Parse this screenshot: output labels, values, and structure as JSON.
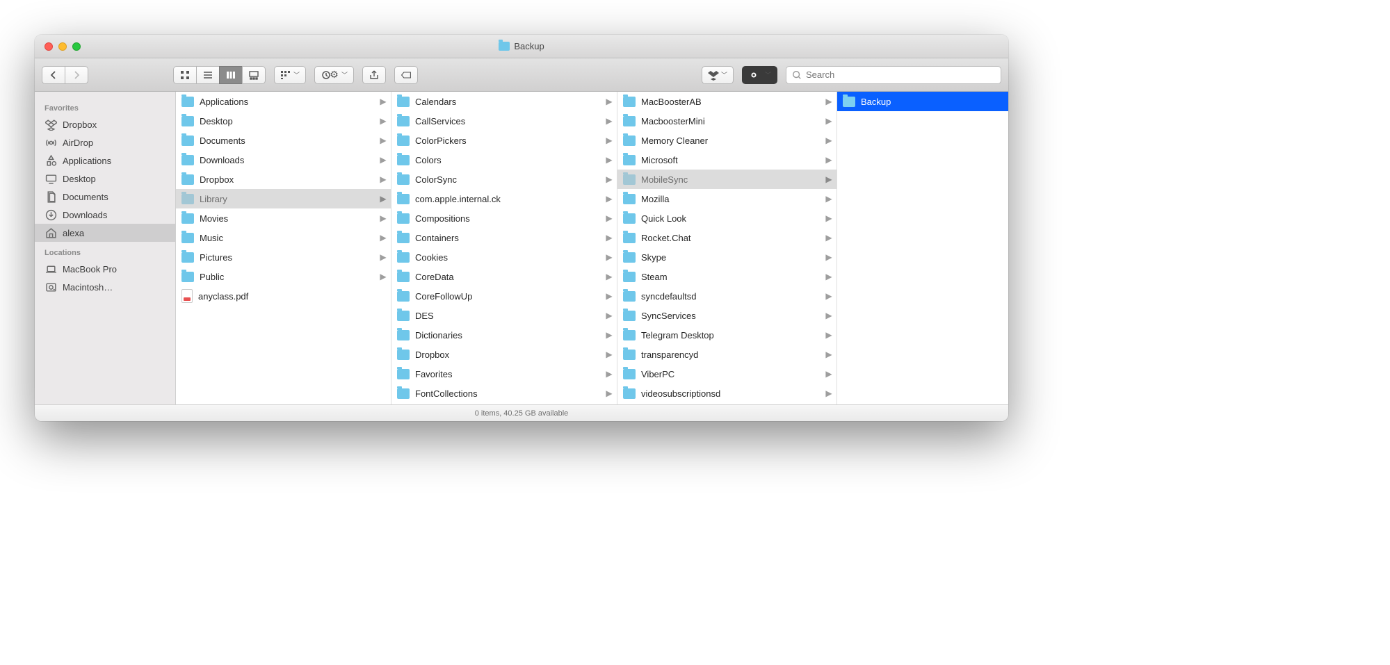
{
  "title": "Backup",
  "search": {
    "placeholder": "Search"
  },
  "status": "0 items, 40.25 GB available",
  "sidebar": {
    "favorites_label": "Favorites",
    "locations_label": "Locations",
    "favorites": [
      {
        "label": "Dropbox",
        "icon": "dropbox",
        "sel": false
      },
      {
        "label": "AirDrop",
        "icon": "airdrop",
        "sel": false
      },
      {
        "label": "Applications",
        "icon": "apps",
        "sel": false
      },
      {
        "label": "Desktop",
        "icon": "desktop",
        "sel": false
      },
      {
        "label": "Documents",
        "icon": "documents",
        "sel": false
      },
      {
        "label": "Downloads",
        "icon": "downloads",
        "sel": false
      },
      {
        "label": "alexa",
        "icon": "home",
        "sel": true
      }
    ],
    "locations": [
      {
        "label": "MacBook Pro",
        "icon": "laptop"
      },
      {
        "label": "Macintosh…",
        "icon": "hdd"
      }
    ]
  },
  "columns": [
    {
      "selected": "Library",
      "items": [
        {
          "name": "Applications",
          "type": "folder",
          "arrow": true
        },
        {
          "name": "Desktop",
          "type": "folder",
          "arrow": true
        },
        {
          "name": "Documents",
          "type": "folder",
          "arrow": true
        },
        {
          "name": "Downloads",
          "type": "folder",
          "arrow": true
        },
        {
          "name": "Dropbox",
          "type": "folder",
          "arrow": true
        },
        {
          "name": "Library",
          "type": "folder",
          "arrow": true,
          "open": true
        },
        {
          "name": "Movies",
          "type": "folder",
          "arrow": true
        },
        {
          "name": "Music",
          "type": "folder",
          "arrow": true
        },
        {
          "name": "Pictures",
          "type": "folder",
          "arrow": true
        },
        {
          "name": "Public",
          "type": "folder",
          "arrow": true
        },
        {
          "name": "anyclass.pdf",
          "type": "file",
          "arrow": false
        }
      ]
    },
    {
      "selected": "",
      "items": [
        {
          "name": "Calendars",
          "type": "folder",
          "arrow": true
        },
        {
          "name": "CallServices",
          "type": "folder",
          "arrow": true
        },
        {
          "name": "ColorPickers",
          "type": "folder",
          "arrow": true
        },
        {
          "name": "Colors",
          "type": "folder",
          "arrow": true
        },
        {
          "name": "ColorSync",
          "type": "folder",
          "arrow": true
        },
        {
          "name": "com.apple.internal.ck",
          "type": "folder",
          "arrow": true
        },
        {
          "name": "Compositions",
          "type": "folder",
          "arrow": true
        },
        {
          "name": "Containers",
          "type": "folder",
          "arrow": true
        },
        {
          "name": "Cookies",
          "type": "folder",
          "arrow": true
        },
        {
          "name": "CoreData",
          "type": "folder",
          "arrow": true
        },
        {
          "name": "CoreFollowUp",
          "type": "folder",
          "arrow": true
        },
        {
          "name": "DES",
          "type": "folder",
          "arrow": true
        },
        {
          "name": "Dictionaries",
          "type": "folder",
          "arrow": true
        },
        {
          "name": "Dropbox",
          "type": "folder",
          "arrow": true
        },
        {
          "name": "Favorites",
          "type": "folder",
          "arrow": true
        },
        {
          "name": "FontCollections",
          "type": "folder",
          "arrow": true
        }
      ]
    },
    {
      "selected": "MobileSync",
      "items": [
        {
          "name": "MacBoosterAB",
          "type": "folder",
          "arrow": true
        },
        {
          "name": "MacboosterMini",
          "type": "folder",
          "arrow": true
        },
        {
          "name": "Memory Cleaner",
          "type": "folder",
          "arrow": true
        },
        {
          "name": "Microsoft",
          "type": "folder",
          "arrow": true
        },
        {
          "name": "MobileSync",
          "type": "folder",
          "arrow": true,
          "open": true
        },
        {
          "name": "Mozilla",
          "type": "folder",
          "arrow": true
        },
        {
          "name": "Quick Look",
          "type": "folder",
          "arrow": true
        },
        {
          "name": "Rocket.Chat",
          "type": "folder",
          "arrow": true
        },
        {
          "name": "Skype",
          "type": "folder",
          "arrow": true
        },
        {
          "name": "Steam",
          "type": "folder",
          "arrow": true
        },
        {
          "name": "syncdefaultsd",
          "type": "folder",
          "arrow": true
        },
        {
          "name": "SyncServices",
          "type": "folder",
          "arrow": true
        },
        {
          "name": "Telegram Desktop",
          "type": "folder",
          "arrow": true
        },
        {
          "name": "transparencyd",
          "type": "folder",
          "arrow": true
        },
        {
          "name": "ViberPC",
          "type": "folder",
          "arrow": true
        },
        {
          "name": "videosubscriptionsd",
          "type": "folder",
          "arrow": true
        }
      ]
    },
    {
      "selected": "Backup",
      "items": [
        {
          "name": "Backup",
          "type": "folder",
          "arrow": false,
          "sel": true
        }
      ]
    }
  ]
}
